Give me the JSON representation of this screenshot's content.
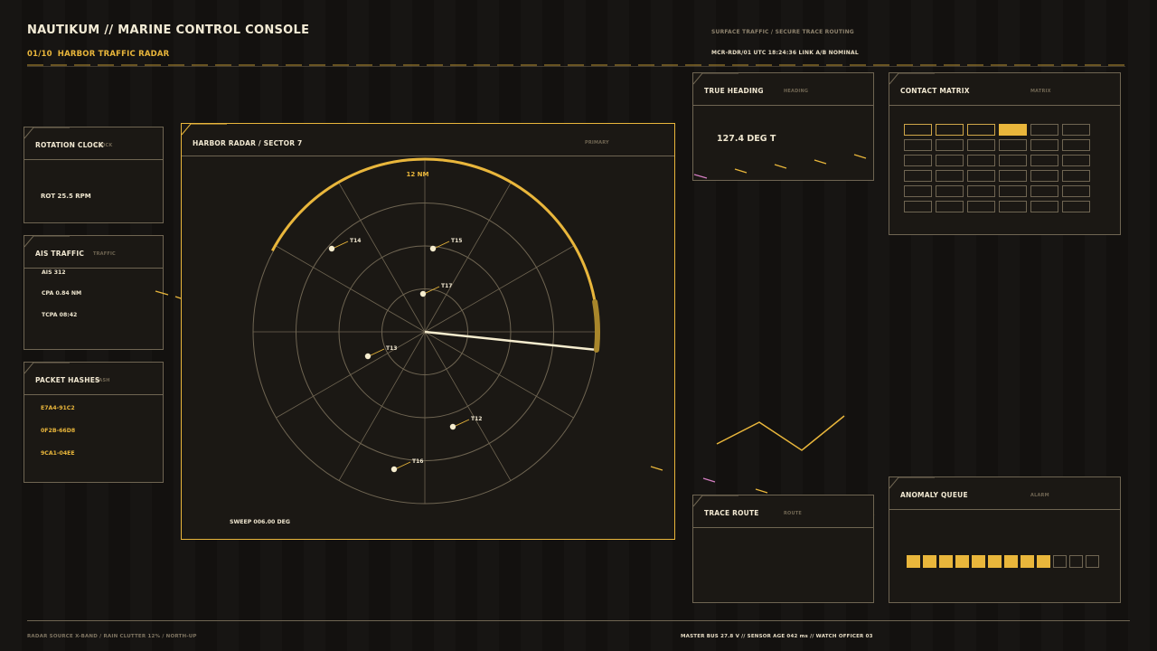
{
  "header": {
    "title": "NAUTIKUM // MARINE CONTROL CONSOLE",
    "page_index": "01/10",
    "page_name": "HARBOR TRAFFIC RADAR",
    "right_top": "SURFACE TRAFFIC / SECURE TRACE ROUTING",
    "right_status": "MCR-RDR/01  UTC 18:24:36  LINK A/B NOMINAL"
  },
  "rotation_clock": {
    "title": "ROTATION CLOCK",
    "tag": "CLOCK",
    "value": "ROT 25.5 RPM"
  },
  "ais_traffic": {
    "title": "AIS TRAFFIC",
    "tag": "TRAFFIC",
    "lines": [
      "AIS 312",
      "CPA 0.84 NM",
      "TCPA 08:42"
    ]
  },
  "packet_hashes": {
    "title": "PACKET HASHES",
    "tag": "HASH",
    "hashes": [
      "E7A4-91C2",
      "0F2B-66D8",
      "9CA1-04EE"
    ]
  },
  "radar": {
    "title": "HARBOR RADAR / SECTOR 7",
    "tag": "PRIMARY",
    "range_label": "12 NM",
    "sweep_label": "SWEEP 006.00 DEG",
    "sweep_deg": 6,
    "targets": [
      {
        "id": "T14",
        "label": "T14"
      },
      {
        "id": "T15",
        "label": "T15"
      },
      {
        "id": "T17",
        "label": "T17"
      },
      {
        "id": "T13",
        "label": "T13"
      },
      {
        "id": "T12",
        "label": "T12"
      },
      {
        "id": "T16",
        "label": "T16"
      }
    ]
  },
  "true_heading": {
    "title": "TRUE HEADING",
    "tag": "HEADING",
    "value": "127.4 DEG T"
  },
  "contact_matrix": {
    "title": "CONTACT MATRIX",
    "tag": "MATRIX",
    "rows": 6,
    "cols": 6,
    "active_cells": [
      3
    ],
    "highlight_cells": [
      0,
      1,
      2
    ]
  },
  "trace_route": {
    "title": "TRACE ROUTE",
    "tag": "ROUTE"
  },
  "anomaly_queue": {
    "title": "ANOMALY QUEUE",
    "tag": "ALARM",
    "level": 9,
    "total": 12
  },
  "footer": {
    "left": "RADAR SOURCE X-BAND / RAIN CLUTTER 12% / NORTH-UP",
    "right": "MASTER BUS 27.8 V  //  SENSOR AGE 042 ms  //  WATCH OFFICER 03"
  },
  "colors": {
    "accent": "#e9b63b",
    "magenta": "#d47fc2",
    "panel_border": "#6f6552",
    "bg": "#141210"
  }
}
